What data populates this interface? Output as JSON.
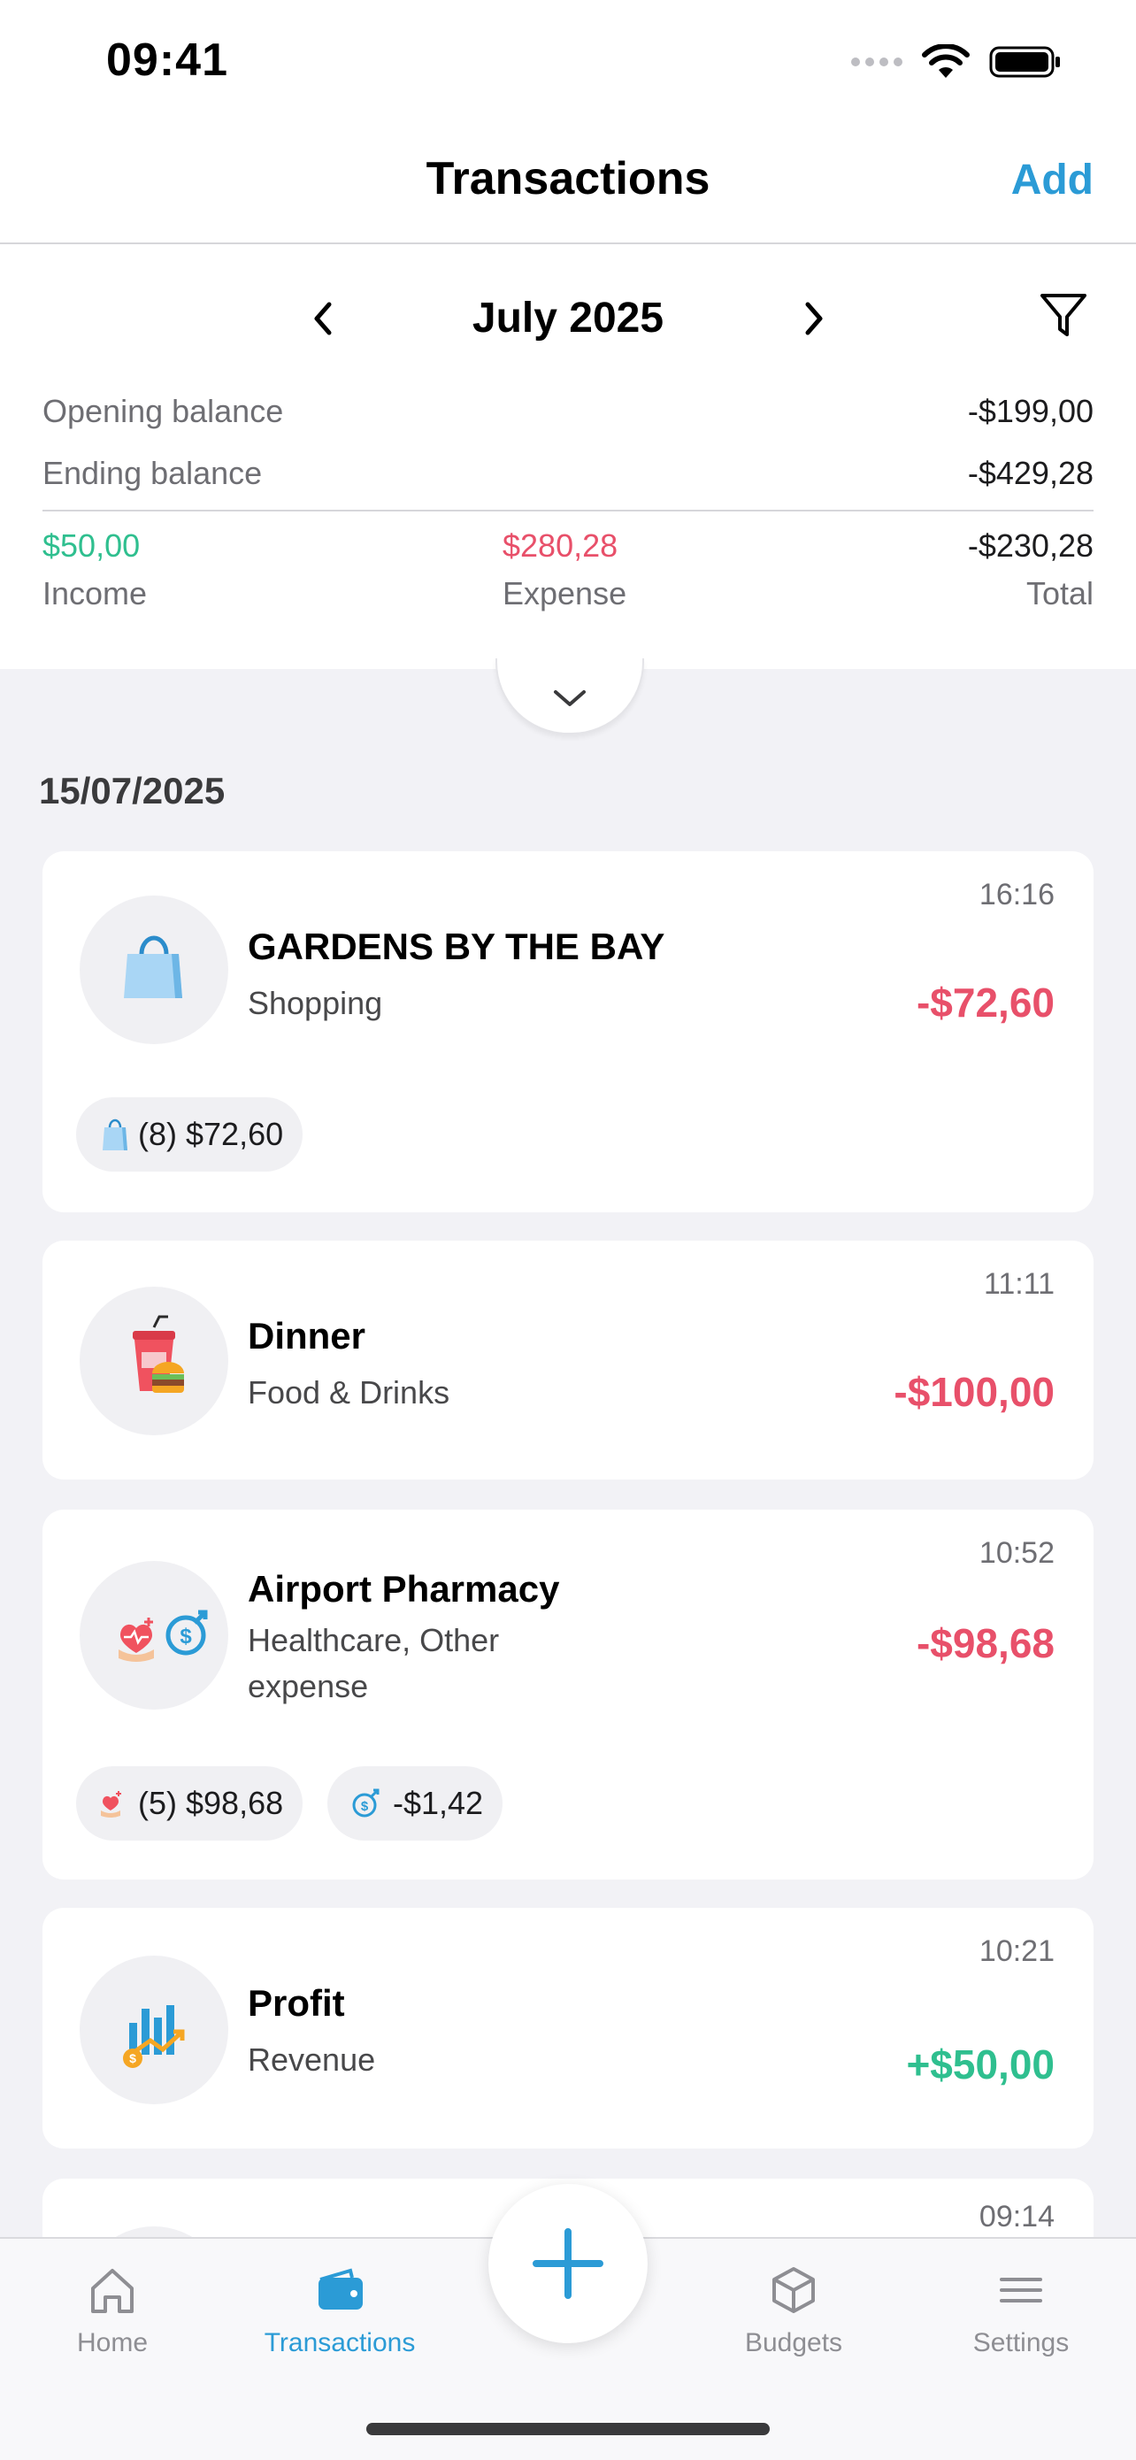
{
  "status_bar": {
    "time": "09:41"
  },
  "nav": {
    "title": "Transactions",
    "add_label": "Add"
  },
  "summary": {
    "month": "July 2025",
    "opening_label": "Opening balance",
    "opening_value": "-$199,00",
    "ending_label": "Ending balance",
    "ending_value": "-$429,28",
    "income_value": "$50,00",
    "income_label": "Income",
    "expense_value": "$280,28",
    "expense_label": "Expense",
    "total_value": "-$230,28",
    "total_label": "Total"
  },
  "list": {
    "date": "15/07/2025",
    "transactions": [
      {
        "title": "GARDENS BY THE BAY",
        "category": "Shopping",
        "time": "16:16",
        "amount": "-$72,60",
        "icon": "shopping-bag-icon",
        "chips": [
          {
            "icon": "shopping-bag-icon",
            "text": "(8) $72,60"
          }
        ]
      },
      {
        "title": "Dinner",
        "category": "Food & Drinks",
        "time": "11:11",
        "amount": "-$100,00",
        "icon": "food-drink-icon",
        "chips": []
      },
      {
        "title": "Airport Pharmacy",
        "category": "Healthcare, Other expense",
        "time": "10:52",
        "amount": "-$98,68",
        "icon": "healthcare-icon",
        "chips": [
          {
            "icon": "healthcare-icon",
            "text": "(5) $98,68"
          },
          {
            "icon": "other-expense-icon",
            "text": "-$1,42"
          }
        ]
      },
      {
        "title": "Profit",
        "category": "Revenue",
        "time": "10:21",
        "amount": "+$50,00",
        "icon": "revenue-chart-icon",
        "chips": []
      },
      {
        "title": "",
        "category": "",
        "time": "09:14",
        "amount": "",
        "icon": "",
        "chips": []
      }
    ]
  },
  "tab_bar": {
    "home": "Home",
    "transactions": "Transactions",
    "budgets": "Budgets",
    "settings": "Settings"
  },
  "colors": {
    "accent": "#2B9BD6",
    "negative": "#E8506A",
    "positive": "#2FBF8F"
  }
}
